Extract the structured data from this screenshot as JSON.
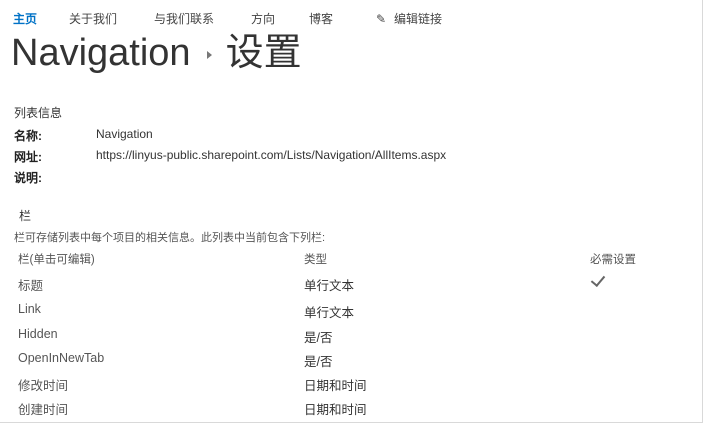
{
  "nav": {
    "items": [
      "主页",
      "关于我们",
      "与我们联系",
      "方向",
      "博客"
    ],
    "active_index": 0,
    "edit_links_label": "编辑链接",
    "edit_icon": "pencil-icon"
  },
  "title": {
    "list_name": "Navigation",
    "page": "设置"
  },
  "list_info": {
    "heading": "列表信息",
    "rows": [
      {
        "label": "名称:",
        "value": "Navigation"
      },
      {
        "label": "网址:",
        "value": "https://linyus-public.sharepoint.com/Lists/Navigation/AllItems.aspx"
      },
      {
        "label": "说明:",
        "value": ""
      }
    ]
  },
  "columns": {
    "heading": "栏",
    "description": "栏可存储列表中每个项目的相关信息。此列表中当前包含下列栏:",
    "headers": [
      "栏(单击可编辑)",
      "类型",
      "必需设置"
    ],
    "rows": [
      {
        "name": "标题",
        "type": "单行文本",
        "required": true
      },
      {
        "name": "Link",
        "type": "单行文本",
        "required": false
      },
      {
        "name": "Hidden",
        "type": "是/否",
        "required": false
      },
      {
        "name": "OpenInNewTab",
        "type": "是/否",
        "required": false
      },
      {
        "name": "修改时间",
        "type": "日期和时间",
        "required": false
      },
      {
        "name": "创建时间",
        "type": "日期和时间",
        "required": false
      }
    ]
  },
  "colors": {
    "accent": "#0072c6",
    "text": "#444444"
  }
}
